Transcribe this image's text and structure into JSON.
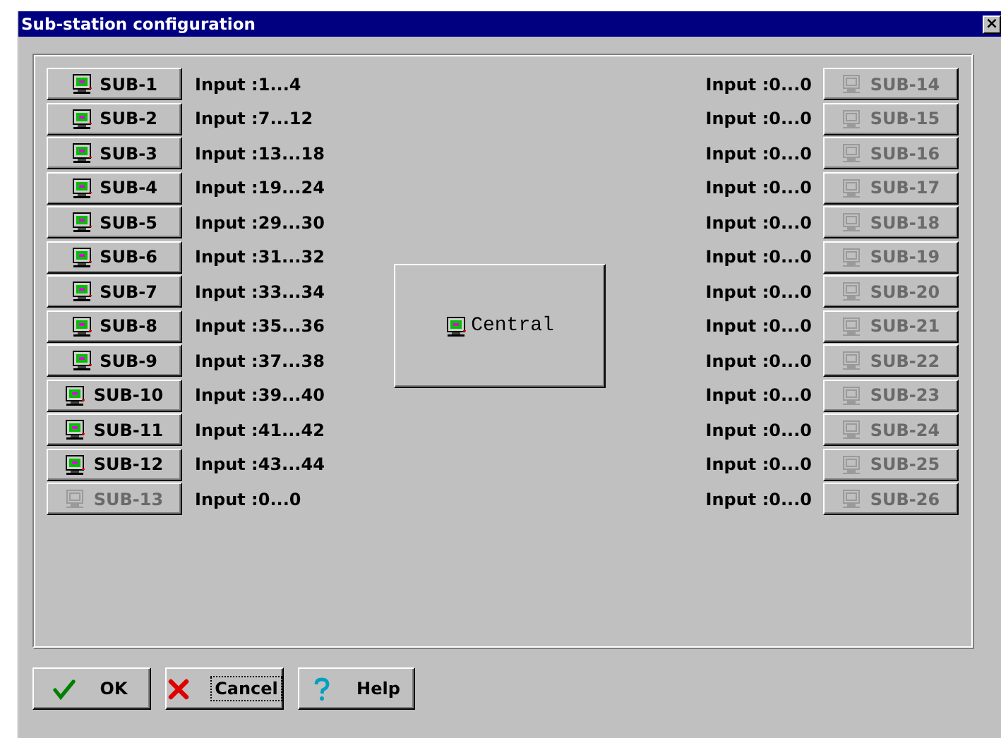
{
  "window": {
    "title": "Sub-station configuration",
    "close": "×"
  },
  "left_stations": [
    {
      "label": "SUB-1",
      "inputs": "Input :1...4",
      "disabled": false
    },
    {
      "label": "SUB-2",
      "inputs": "Input :7...12",
      "disabled": false
    },
    {
      "label": "SUB-3",
      "inputs": "Input :13...18",
      "disabled": false
    },
    {
      "label": "SUB-4",
      "inputs": "Input :19...24",
      "disabled": false
    },
    {
      "label": "SUB-5",
      "inputs": "Input :29...30",
      "disabled": false
    },
    {
      "label": "SUB-6",
      "inputs": "Input :31...32",
      "disabled": false
    },
    {
      "label": "SUB-7",
      "inputs": "Input :33...34",
      "disabled": false
    },
    {
      "label": "SUB-8",
      "inputs": "Input :35...36",
      "disabled": false
    },
    {
      "label": "SUB-9",
      "inputs": "Input :37...38",
      "disabled": false
    },
    {
      "label": "SUB-10",
      "inputs": "Input :39...40",
      "disabled": false
    },
    {
      "label": "SUB-11",
      "inputs": "Input :41...42",
      "disabled": false
    },
    {
      "label": "SUB-12",
      "inputs": "Input :43...44",
      "disabled": false
    },
    {
      "label": "SUB-13",
      "inputs": "Input :0...0",
      "disabled": true
    }
  ],
  "central": {
    "label": "Central"
  },
  "right_stations": [
    {
      "label": "SUB-14",
      "inputs": "Input :0...0",
      "disabled": true
    },
    {
      "label": "SUB-15",
      "inputs": "Input :0...0",
      "disabled": true
    },
    {
      "label": "SUB-16",
      "inputs": "Input :0...0",
      "disabled": true
    },
    {
      "label": "SUB-17",
      "inputs": "Input :0...0",
      "disabled": true
    },
    {
      "label": "SUB-18",
      "inputs": "Input :0...0",
      "disabled": true
    },
    {
      "label": "SUB-19",
      "inputs": "Input :0...0",
      "disabled": true
    },
    {
      "label": "SUB-20",
      "inputs": "Input :0...0",
      "disabled": true
    },
    {
      "label": "SUB-21",
      "inputs": "Input :0...0",
      "disabled": true
    },
    {
      "label": "SUB-22",
      "inputs": "Input :0...0",
      "disabled": true
    },
    {
      "label": "SUB-23",
      "inputs": "Input :0...0",
      "disabled": true
    },
    {
      "label": "SUB-24",
      "inputs": "Input :0...0",
      "disabled": true
    },
    {
      "label": "SUB-25",
      "inputs": "Input :0...0",
      "disabled": true
    },
    {
      "label": "SUB-26",
      "inputs": "Input :0...0",
      "disabled": true
    }
  ],
  "buttons": [
    {
      "kind": "ok",
      "label": "OK",
      "focused": false
    },
    {
      "kind": "cancel",
      "label": "Cancel",
      "focused": true
    },
    {
      "kind": "help",
      "label": "Help",
      "focused": false
    }
  ]
}
